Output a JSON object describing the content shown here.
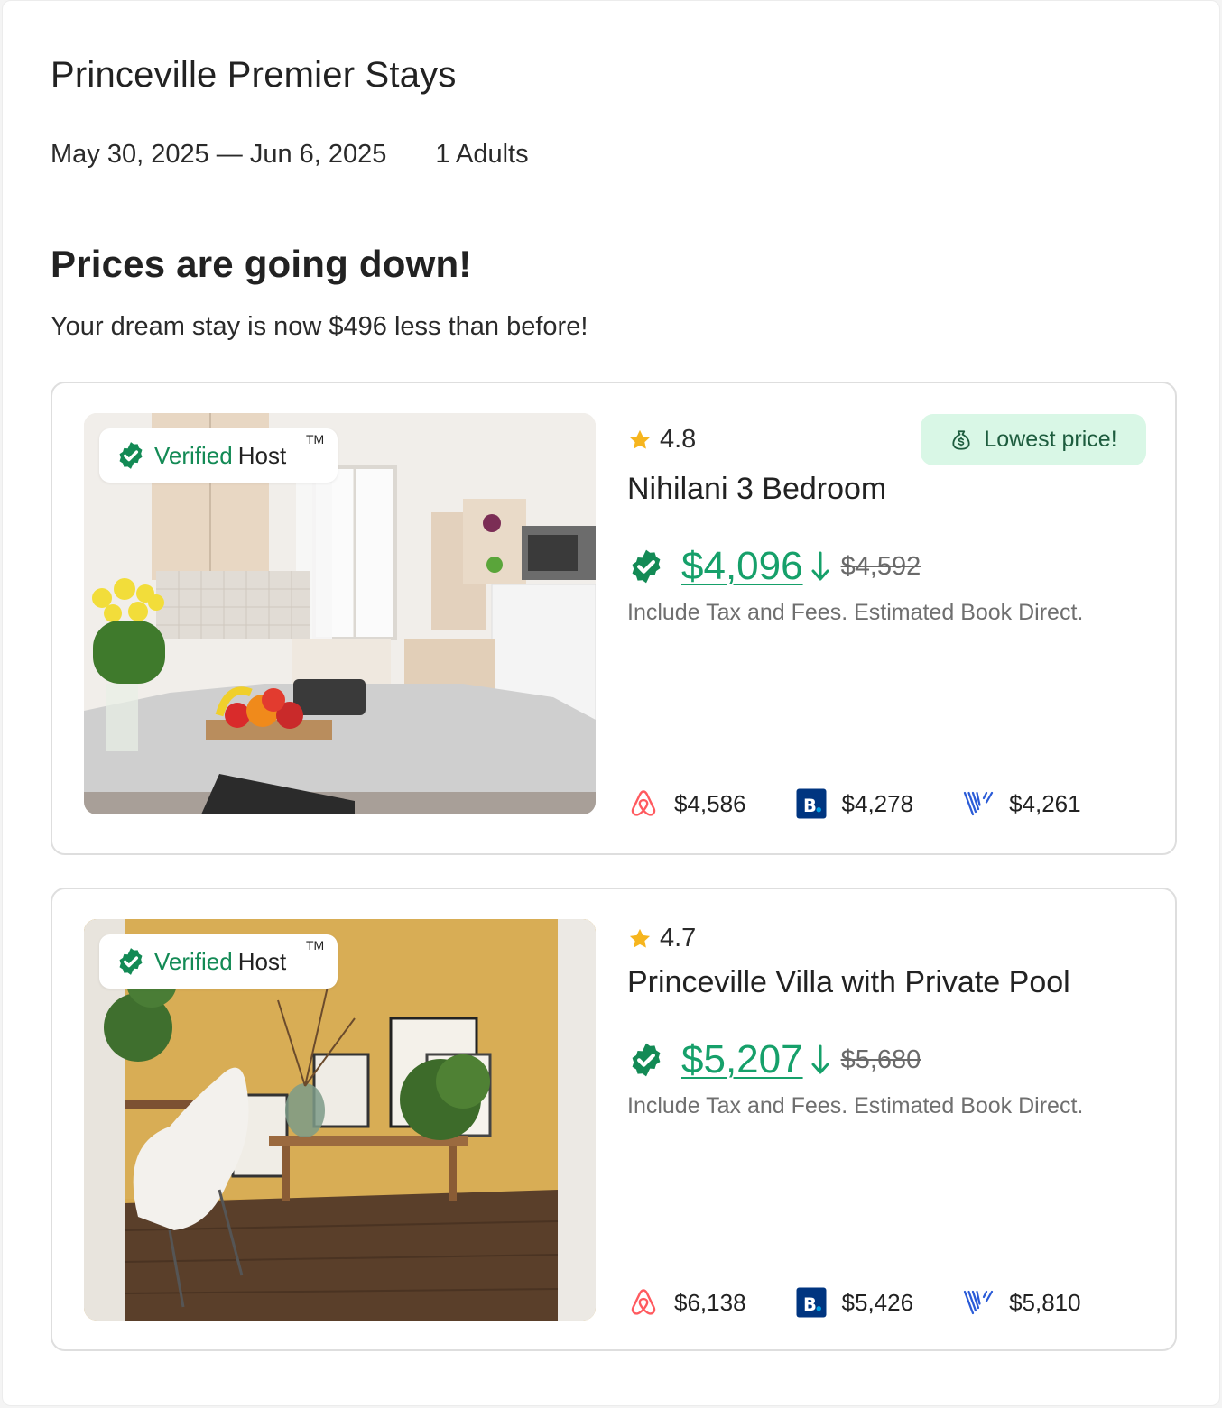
{
  "header": {
    "title": "Princeville Premier Stays",
    "dates": "May 30, 2025 — Jun 6, 2025",
    "guests": "1 Adults"
  },
  "alert": {
    "headline": "Prices are going down!",
    "message": "Your dream stay is now $496 less than before!"
  },
  "listings": [
    {
      "verified_word": "Verified",
      "host_word": "Host",
      "tm": "TM",
      "rating": "4.8",
      "badge": "Lowest price!",
      "name": "Nihilani 3 Bedroom",
      "price": "$4,096",
      "old_price": "$4,592",
      "note": "Include Tax and Fees. Estimated Book Direct.",
      "ota_prices": {
        "airbnb": "$4,586",
        "booking": "$4,278",
        "vrbo": "$4,261"
      }
    },
    {
      "verified_word": "Verified",
      "host_word": "Host",
      "tm": "TM",
      "rating": "4.7",
      "name": "Princeville Villa with Private Pool",
      "price": "$5,207",
      "old_price": "$5,680",
      "note": "Include Tax and Fees. Estimated Book Direct.",
      "ota_prices": {
        "airbnb": "$6,138",
        "booking": "$5,426",
        "vrbo": "$5,810"
      }
    }
  ],
  "icons": {
    "verified": "verified-check-icon",
    "star": "star-icon",
    "money_bag": "money-bag-icon",
    "arrow": "arrow-down-icon",
    "airbnb": "airbnb-logo-icon",
    "booking": "booking-logo-icon",
    "vrbo": "vrbo-logo-icon"
  },
  "colors": {
    "accent_green": "#16a06a",
    "verified_green": "#138a55",
    "badge_bg": "#d9f7e6",
    "star": "#f6b51e",
    "airbnb": "#ff5a5f",
    "booking": "#003580",
    "vrbo": "#2a5bd7"
  }
}
